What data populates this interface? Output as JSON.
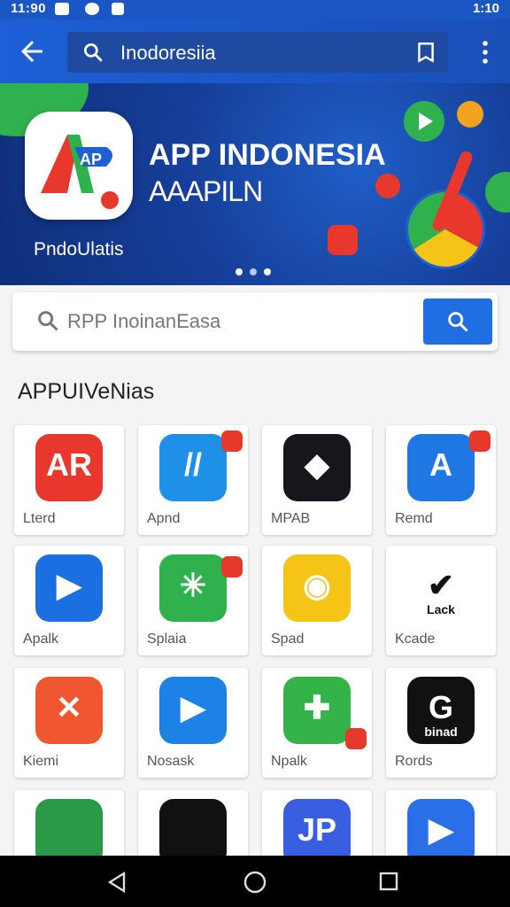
{
  "status": {
    "time": "11:90",
    "right": "1:10"
  },
  "appbar": {
    "search_value": "Inodoresiia",
    "icons": [
      "back-arrow-icon",
      "search-icon",
      "bookmark-icon",
      "more-vert-icon"
    ]
  },
  "banner": {
    "title": "APP INDONESIA",
    "subtitle": "AAAPILN",
    "brand": "PndoUlatis",
    "logo_text": "AP"
  },
  "search": {
    "placeholder": "RPP InoinanEasa"
  },
  "section": {
    "heading": "APPUIVeNias"
  },
  "apps": [
    {
      "label": "Lterd",
      "color": "#e8382d",
      "glyph": "AR"
    },
    {
      "label": "Apnd",
      "color": "#1e90e8",
      "glyph": "//"
    },
    {
      "label": "MPAB",
      "color": "#15171c",
      "glyph": "◆"
    },
    {
      "label": "Remd",
      "color": "#1f77e3",
      "glyph": "A"
    },
    {
      "label": "Apalk",
      "color": "#1b6fe0",
      "glyph": "▶"
    },
    {
      "label": "Splaia",
      "color": "#2fb14e",
      "glyph": "✳"
    },
    {
      "label": "Spad",
      "color": "#f6c416",
      "glyph": "◉"
    },
    {
      "label": "Kcade",
      "color": "#ffffff",
      "glyph": "✔"
    },
    {
      "label": "Kiemi",
      "color": "#f0562f",
      "glyph": "✕"
    },
    {
      "label": "Nosask",
      "color": "#1c82e6",
      "glyph": "▶"
    },
    {
      "label": "Npalk",
      "color": "#34b348",
      "glyph": "✚"
    },
    {
      "label": "Rords",
      "color": "#111111",
      "glyph": "G"
    },
    {
      "label": "",
      "color": "#2a9a48",
      "glyph": ""
    },
    {
      "label": "",
      "color": "#111111",
      "glyph": ""
    },
    {
      "label": "",
      "color": "#3a5ee0",
      "glyph": "JP"
    },
    {
      "label": "",
      "color": "#2a6ee8",
      "glyph": "▶"
    }
  ],
  "apps_subtext": {
    "tile8": "Lack",
    "tile12": "binad"
  }
}
